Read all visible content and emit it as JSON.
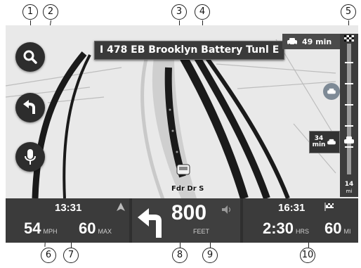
{
  "callouts": [
    "1",
    "2",
    "3",
    "4",
    "5",
    "6",
    "7",
    "8",
    "9",
    "10"
  ],
  "street_name": "I 478 EB Brooklyn Battery Tunl E",
  "next_street": "Fdr Dr S",
  "traffic": {
    "total_delay": "49 min",
    "incident_delay_value": "34",
    "incident_delay_unit": "min",
    "distance_value": "14",
    "distance_unit": "mi"
  },
  "current_speed": {
    "value": "54",
    "unit": "MPH"
  },
  "arrival_time_left": "13:31",
  "speed_limit": {
    "value": "60",
    "label": "MAX"
  },
  "instruction": {
    "distance": "800",
    "unit": "FEET"
  },
  "arrival": {
    "time": "16:31",
    "remaining": "2:30",
    "remaining_unit": "HRS",
    "distance": "60",
    "distance_unit": "MI"
  },
  "icons": [
    "search-icon",
    "back-arrow-icon",
    "microphone-icon",
    "car-icon",
    "checkered-flag-icon",
    "speaker-icon",
    "turn-left-arrow-icon",
    "north-arrow-icon"
  ],
  "colors": {
    "road_dark": "#1a1a1a",
    "panel": "#3b3b3b",
    "map_bg": "#e9e9e9"
  }
}
